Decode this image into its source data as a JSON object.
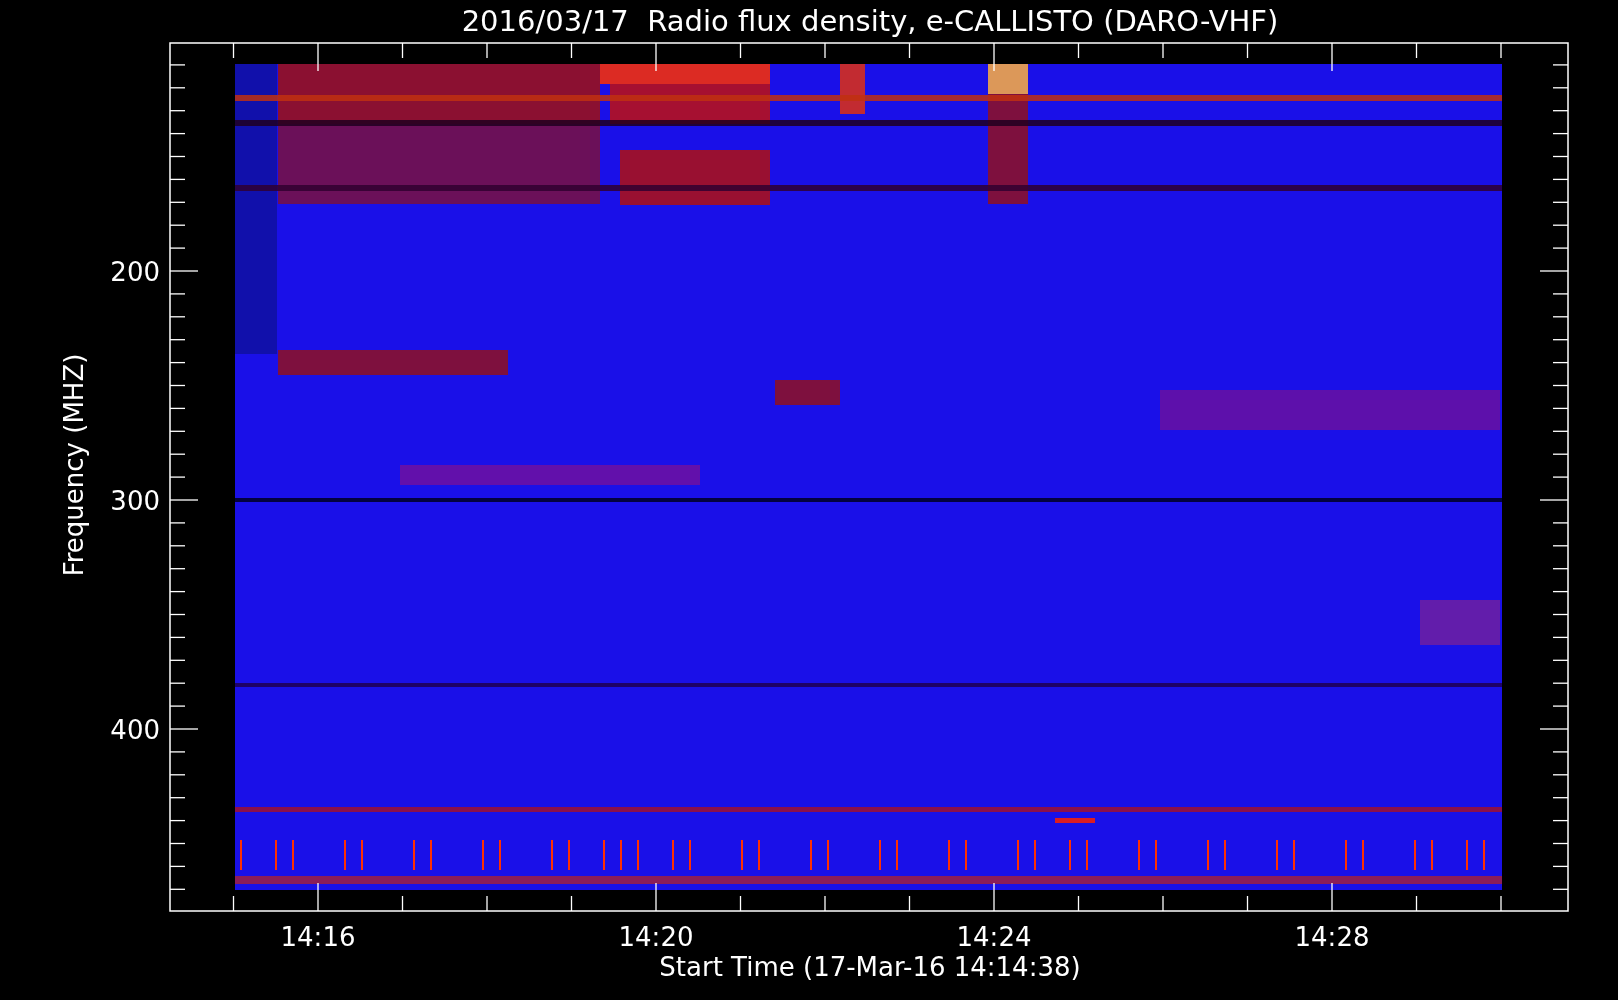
{
  "title": "2016/03/17  Radio flux density, e-CALLISTO (DARO-VHF)",
  "plot": {
    "ylabel": "Frequency (MHZ)",
    "xlabel": "Start Time (17-Mar-16 14:14:38)",
    "yticks": [
      "200",
      "300",
      "400"
    ],
    "xticks": [
      "14:16",
      "14:20",
      "14:24",
      "14:28"
    ]
  }
}
